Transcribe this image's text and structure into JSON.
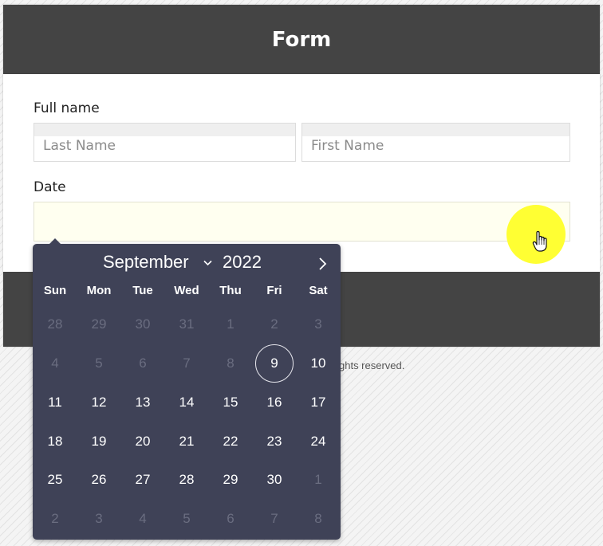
{
  "form": {
    "title": "Form",
    "full_name_label": "Full name",
    "last_name_placeholder": "Last Name",
    "first_name_placeholder": "First Name",
    "date_label": "Date",
    "date_value": ""
  },
  "footer": {
    "copyright_fragment": "ghts reserved."
  },
  "cursor": {
    "icon": "hand-pointer-icon",
    "highlight_color": "#ffff33"
  },
  "calendar": {
    "month": "September",
    "year": "2022",
    "weekdays": [
      "Sun",
      "Mon",
      "Tue",
      "Wed",
      "Thu",
      "Fri",
      "Sat"
    ],
    "weeks": [
      [
        {
          "d": "28",
          "o": true
        },
        {
          "d": "29",
          "o": true
        },
        {
          "d": "30",
          "o": true
        },
        {
          "d": "31",
          "o": true
        },
        {
          "d": "1",
          "o": true
        },
        {
          "d": "2",
          "o": true
        },
        {
          "d": "3",
          "o": true
        }
      ],
      [
        {
          "d": "4",
          "o": true
        },
        {
          "d": "5",
          "o": true
        },
        {
          "d": "6",
          "o": true
        },
        {
          "d": "7",
          "o": true
        },
        {
          "d": "8",
          "o": true
        },
        {
          "d": "9",
          "o": false,
          "today": true
        },
        {
          "d": "10",
          "o": false
        }
      ],
      [
        {
          "d": "11",
          "o": false
        },
        {
          "d": "12",
          "o": false
        },
        {
          "d": "13",
          "o": false
        },
        {
          "d": "14",
          "o": false
        },
        {
          "d": "15",
          "o": false
        },
        {
          "d": "16",
          "o": false
        },
        {
          "d": "17",
          "o": false
        }
      ],
      [
        {
          "d": "18",
          "o": false
        },
        {
          "d": "19",
          "o": false
        },
        {
          "d": "20",
          "o": false
        },
        {
          "d": "21",
          "o": false
        },
        {
          "d": "22",
          "o": false
        },
        {
          "d": "23",
          "o": false
        },
        {
          "d": "24",
          "o": false
        }
      ],
      [
        {
          "d": "25",
          "o": false
        },
        {
          "d": "26",
          "o": false
        },
        {
          "d": "27",
          "o": false
        },
        {
          "d": "28",
          "o": false
        },
        {
          "d": "29",
          "o": false
        },
        {
          "d": "30",
          "o": false
        },
        {
          "d": "1",
          "o": true
        }
      ],
      [
        {
          "d": "2",
          "o": true
        },
        {
          "d": "3",
          "o": true
        },
        {
          "d": "4",
          "o": true
        },
        {
          "d": "5",
          "o": true
        },
        {
          "d": "6",
          "o": true
        },
        {
          "d": "7",
          "o": true
        },
        {
          "d": "8",
          "o": true
        }
      ]
    ],
    "colors": {
      "background": "#3f4257",
      "day_text": "#ffffff",
      "other_month_text": "#6a6d80"
    }
  }
}
